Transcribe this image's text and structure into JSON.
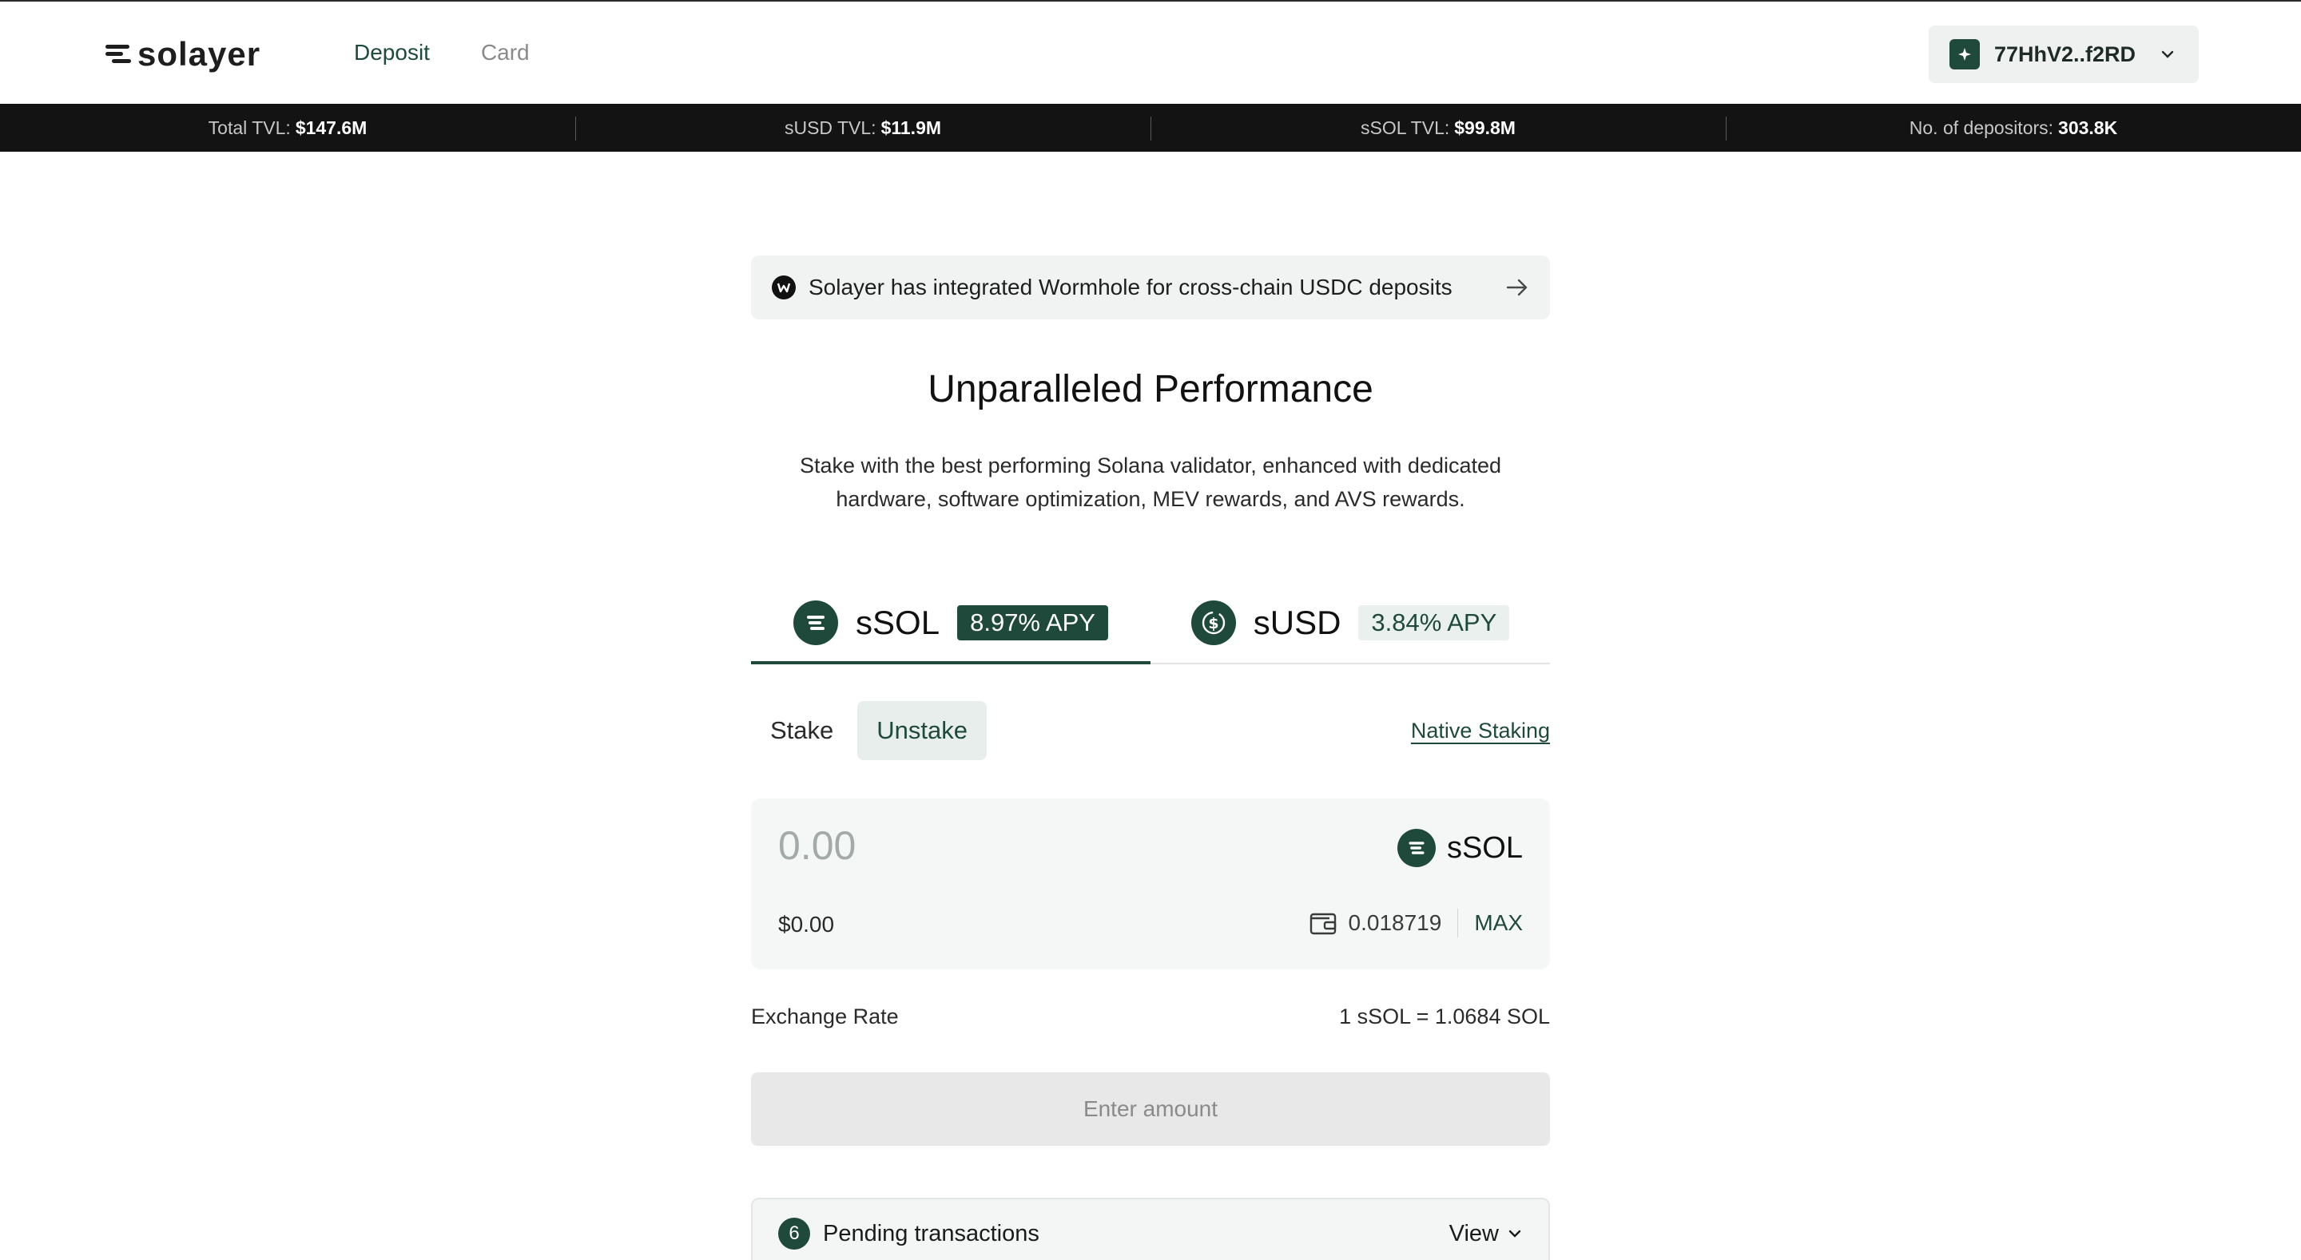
{
  "brand": {
    "name": "solayer"
  },
  "nav": {
    "items": [
      {
        "label": "Deposit",
        "active": true
      },
      {
        "label": "Card",
        "active": false
      }
    ]
  },
  "wallet": {
    "address": "77HhV2..f2RD"
  },
  "stats": [
    {
      "label": "Total TVL:",
      "value": "$147.6M"
    },
    {
      "label": "sUSD TVL:",
      "value": "$11.9M"
    },
    {
      "label": "sSOL TVL:",
      "value": "$99.8M"
    },
    {
      "label": "No. of depositors:",
      "value": "303.8K"
    }
  ],
  "banner": {
    "text": "Solayer has integrated Wormhole for cross-chain USDC deposits"
  },
  "hero": {
    "title": "Unparalleled Performance",
    "subtitle": "Stake with the best performing Solana validator, enhanced with dedicated hardware, software optimization, MEV rewards, and AVS rewards."
  },
  "tabs": [
    {
      "name": "sSOL",
      "apy": "8.97% APY",
      "active": true
    },
    {
      "name": "sUSD",
      "apy": "3.84% APY",
      "active": false
    }
  ],
  "modes": {
    "stake": "Stake",
    "unstake": "Unstake",
    "selected": "Unstake",
    "native_link": "Native Staking"
  },
  "input": {
    "placeholder": "0.00",
    "token": "sSOL",
    "usd_value": "$0.00",
    "balance": "0.018719",
    "max_label": "MAX"
  },
  "exchange": {
    "label": "Exchange Rate",
    "value": "1 sSOL = 1.0684 SOL"
  },
  "action": {
    "label": "Enter amount"
  },
  "pending": {
    "count": "6",
    "label": "Pending transactions",
    "view_label": "View"
  },
  "colors": {
    "accent": "#1f4a3b",
    "stats_bg": "#131313",
    "card_bg": "#f5f7f6"
  }
}
